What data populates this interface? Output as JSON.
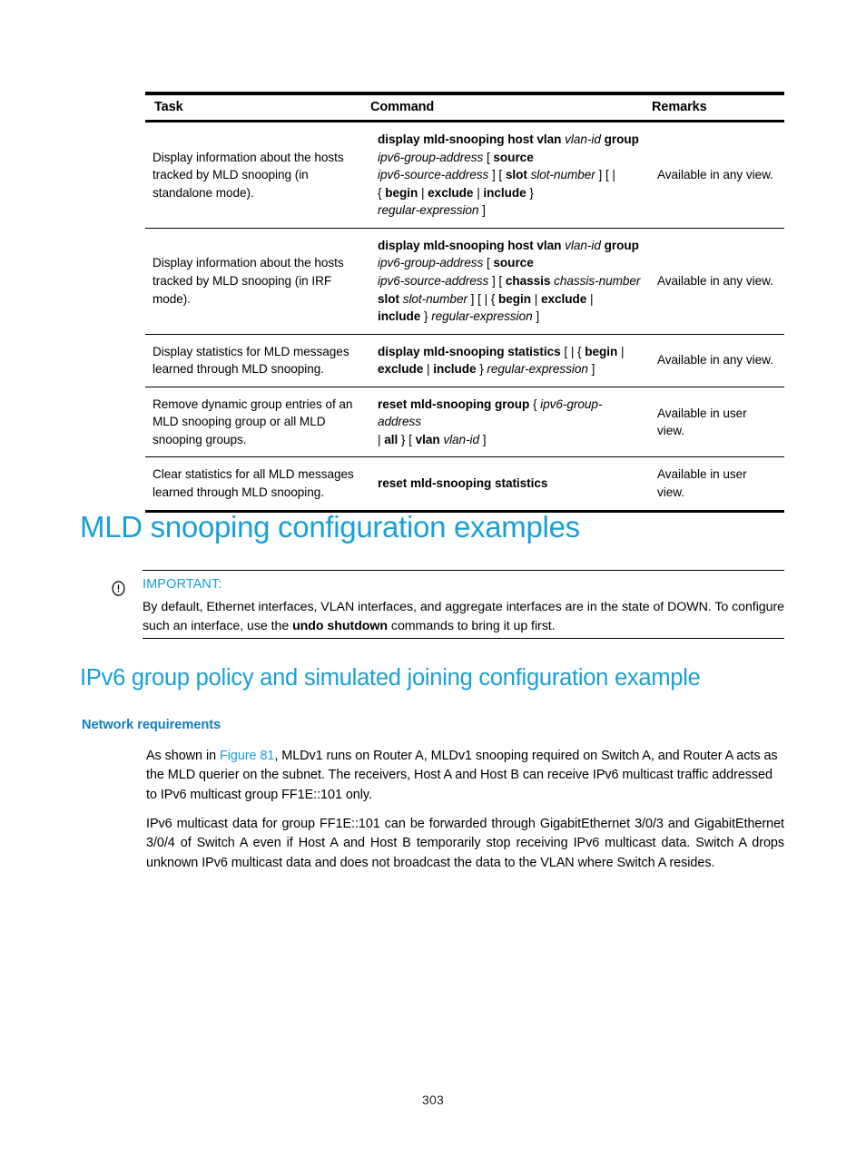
{
  "table": {
    "headers": {
      "task": "Task",
      "command": "Command",
      "remarks": "Remarks"
    },
    "rows": [
      {
        "task": "Display information about the hosts tracked by MLD snooping (in standalone mode).",
        "command_lines": [
          [
            {
              "t": "display mld-snooping host vlan ",
              "s": "kw"
            },
            {
              "t": "vlan-id ",
              "s": "par"
            },
            {
              "t": "group",
              "s": "kw"
            }
          ],
          [
            {
              "t": "ipv6-group-address ",
              "s": "par"
            },
            {
              "t": "[ ",
              "s": "plain"
            },
            {
              "t": "source",
              "s": "kw"
            }
          ],
          [
            {
              "t": "ipv6-source-address ",
              "s": "par"
            },
            {
              "t": "] [ ",
              "s": "plain"
            },
            {
              "t": "slot ",
              "s": "kw"
            },
            {
              "t": "slot-number ",
              "s": "par"
            },
            {
              "t": "] [ |",
              "s": "plain"
            }
          ],
          [
            {
              "t": "{ ",
              "s": "plain"
            },
            {
              "t": "begin ",
              "s": "kw"
            },
            {
              "t": "| ",
              "s": "plain"
            },
            {
              "t": "exclude ",
              "s": "kw"
            },
            {
              "t": "| ",
              "s": "plain"
            },
            {
              "t": "include ",
              "s": "kw"
            },
            {
              "t": "}",
              "s": "plain"
            }
          ],
          [
            {
              "t": "regular-expression ",
              "s": "par"
            },
            {
              "t": "]",
              "s": "plain"
            }
          ]
        ],
        "remarks": "Available in any view."
      },
      {
        "task": "Display information about the hosts tracked by MLD snooping (in IRF mode).",
        "command_lines": [
          [
            {
              "t": "display mld-snooping host vlan ",
              "s": "kw"
            },
            {
              "t": "vlan-id ",
              "s": "par"
            },
            {
              "t": "group",
              "s": "kw"
            }
          ],
          [
            {
              "t": "ipv6-group-address ",
              "s": "par"
            },
            {
              "t": "[ ",
              "s": "plain"
            },
            {
              "t": "source",
              "s": "kw"
            }
          ],
          [
            {
              "t": "ipv6-source-address ",
              "s": "par"
            },
            {
              "t": "] [ ",
              "s": "plain"
            },
            {
              "t": "chassis ",
              "s": "kw"
            },
            {
              "t": "chassis-number",
              "s": "par"
            }
          ],
          [
            {
              "t": "slot ",
              "s": "kw"
            },
            {
              "t": "slot-number ",
              "s": "par"
            },
            {
              "t": "] [ | { ",
              "s": "plain"
            },
            {
              "t": "begin ",
              "s": "kw"
            },
            {
              "t": "| ",
              "s": "plain"
            },
            {
              "t": "exclude ",
              "s": "kw"
            },
            {
              "t": "|",
              "s": "plain"
            }
          ],
          [
            {
              "t": "include ",
              "s": "kw"
            },
            {
              "t": "} ",
              "s": "plain"
            },
            {
              "t": "regular-expression ",
              "s": "par"
            },
            {
              "t": "]",
              "s": "plain"
            }
          ]
        ],
        "remarks": "Available in any view."
      },
      {
        "task": "Display statistics for MLD messages learned through MLD snooping.",
        "command_lines": [
          [
            {
              "t": "display mld-snooping statistics ",
              "s": "kw"
            },
            {
              "t": "[ | { ",
              "s": "plain"
            },
            {
              "t": "begin ",
              "s": "kw"
            },
            {
              "t": "|",
              "s": "plain"
            }
          ],
          [
            {
              "t": "exclude ",
              "s": "kw"
            },
            {
              "t": "| ",
              "s": "plain"
            },
            {
              "t": "include ",
              "s": "kw"
            },
            {
              "t": "} ",
              "s": "plain"
            },
            {
              "t": "regular-expression ",
              "s": "par"
            },
            {
              "t": "]",
              "s": "plain"
            }
          ]
        ],
        "remarks": "Available in any view."
      },
      {
        "task": "Remove dynamic group entries of an MLD snooping group or all MLD snooping groups.",
        "command_lines": [
          [
            {
              "t": "reset mld-snooping group ",
              "s": "kw"
            },
            {
              "t": "{ ",
              "s": "plain"
            },
            {
              "t": "ipv6-group-address",
              "s": "par"
            }
          ],
          [
            {
              "t": "| ",
              "s": "plain"
            },
            {
              "t": "all ",
              "s": "kw"
            },
            {
              "t": "} [ ",
              "s": "plain"
            },
            {
              "t": "vlan ",
              "s": "kw"
            },
            {
              "t": "vlan-id ",
              "s": "par"
            },
            {
              "t": "]",
              "s": "plain"
            }
          ]
        ],
        "remarks": "Available in user view."
      },
      {
        "task": "Clear statistics for all MLD messages learned through MLD snooping.",
        "command_lines": [
          [
            {
              "t": "reset mld-snooping statistics",
              "s": "kw"
            }
          ]
        ],
        "remarks": "Available in user view."
      }
    ]
  },
  "headings": {
    "h1": "MLD snooping configuration examples",
    "h2": "IPv6 group policy and simulated joining configuration example",
    "h3": "Network requirements"
  },
  "note": {
    "icon": "exclamation-circle-icon",
    "title": "IMPORTANT:",
    "text_before_bold": "By default, Ethernet interfaces, VLAN interfaces, and aggregate interfaces are in the state of DOWN. To configure such an interface, use the ",
    "bold": "undo shutdown",
    "text_after_bold": " commands to bring it up first."
  },
  "paragraphs": {
    "p1_a": "As shown in ",
    "p1_link": "Figure 81",
    "p1_b": ", MLDv1 runs on Router A, MLDv1 snooping required on Switch A, and Router A acts as the MLD querier on the subnet. The receivers, Host A and Host B can receive IPv6 multicast traffic addressed to IPv6 multicast group FF1E::101 only.",
    "p2": "IPv6 multicast data for group FF1E::101 can be forwarded through GigabitEthernet 3/0/3 and GigabitEthernet 3/0/4 of Switch A even if Host A and Host B temporarily stop receiving IPv6 multicast data. Switch A drops unknown IPv6 multicast data and does not broadcast the data to the VLAN where Switch A resides."
  },
  "footer": {
    "page_number": "303"
  },
  "colors": {
    "heading_blue": "#18a0d4",
    "subheading_blue": "#0d80bf",
    "link_blue": "#18a0d4",
    "rule_black": "#000000"
  }
}
